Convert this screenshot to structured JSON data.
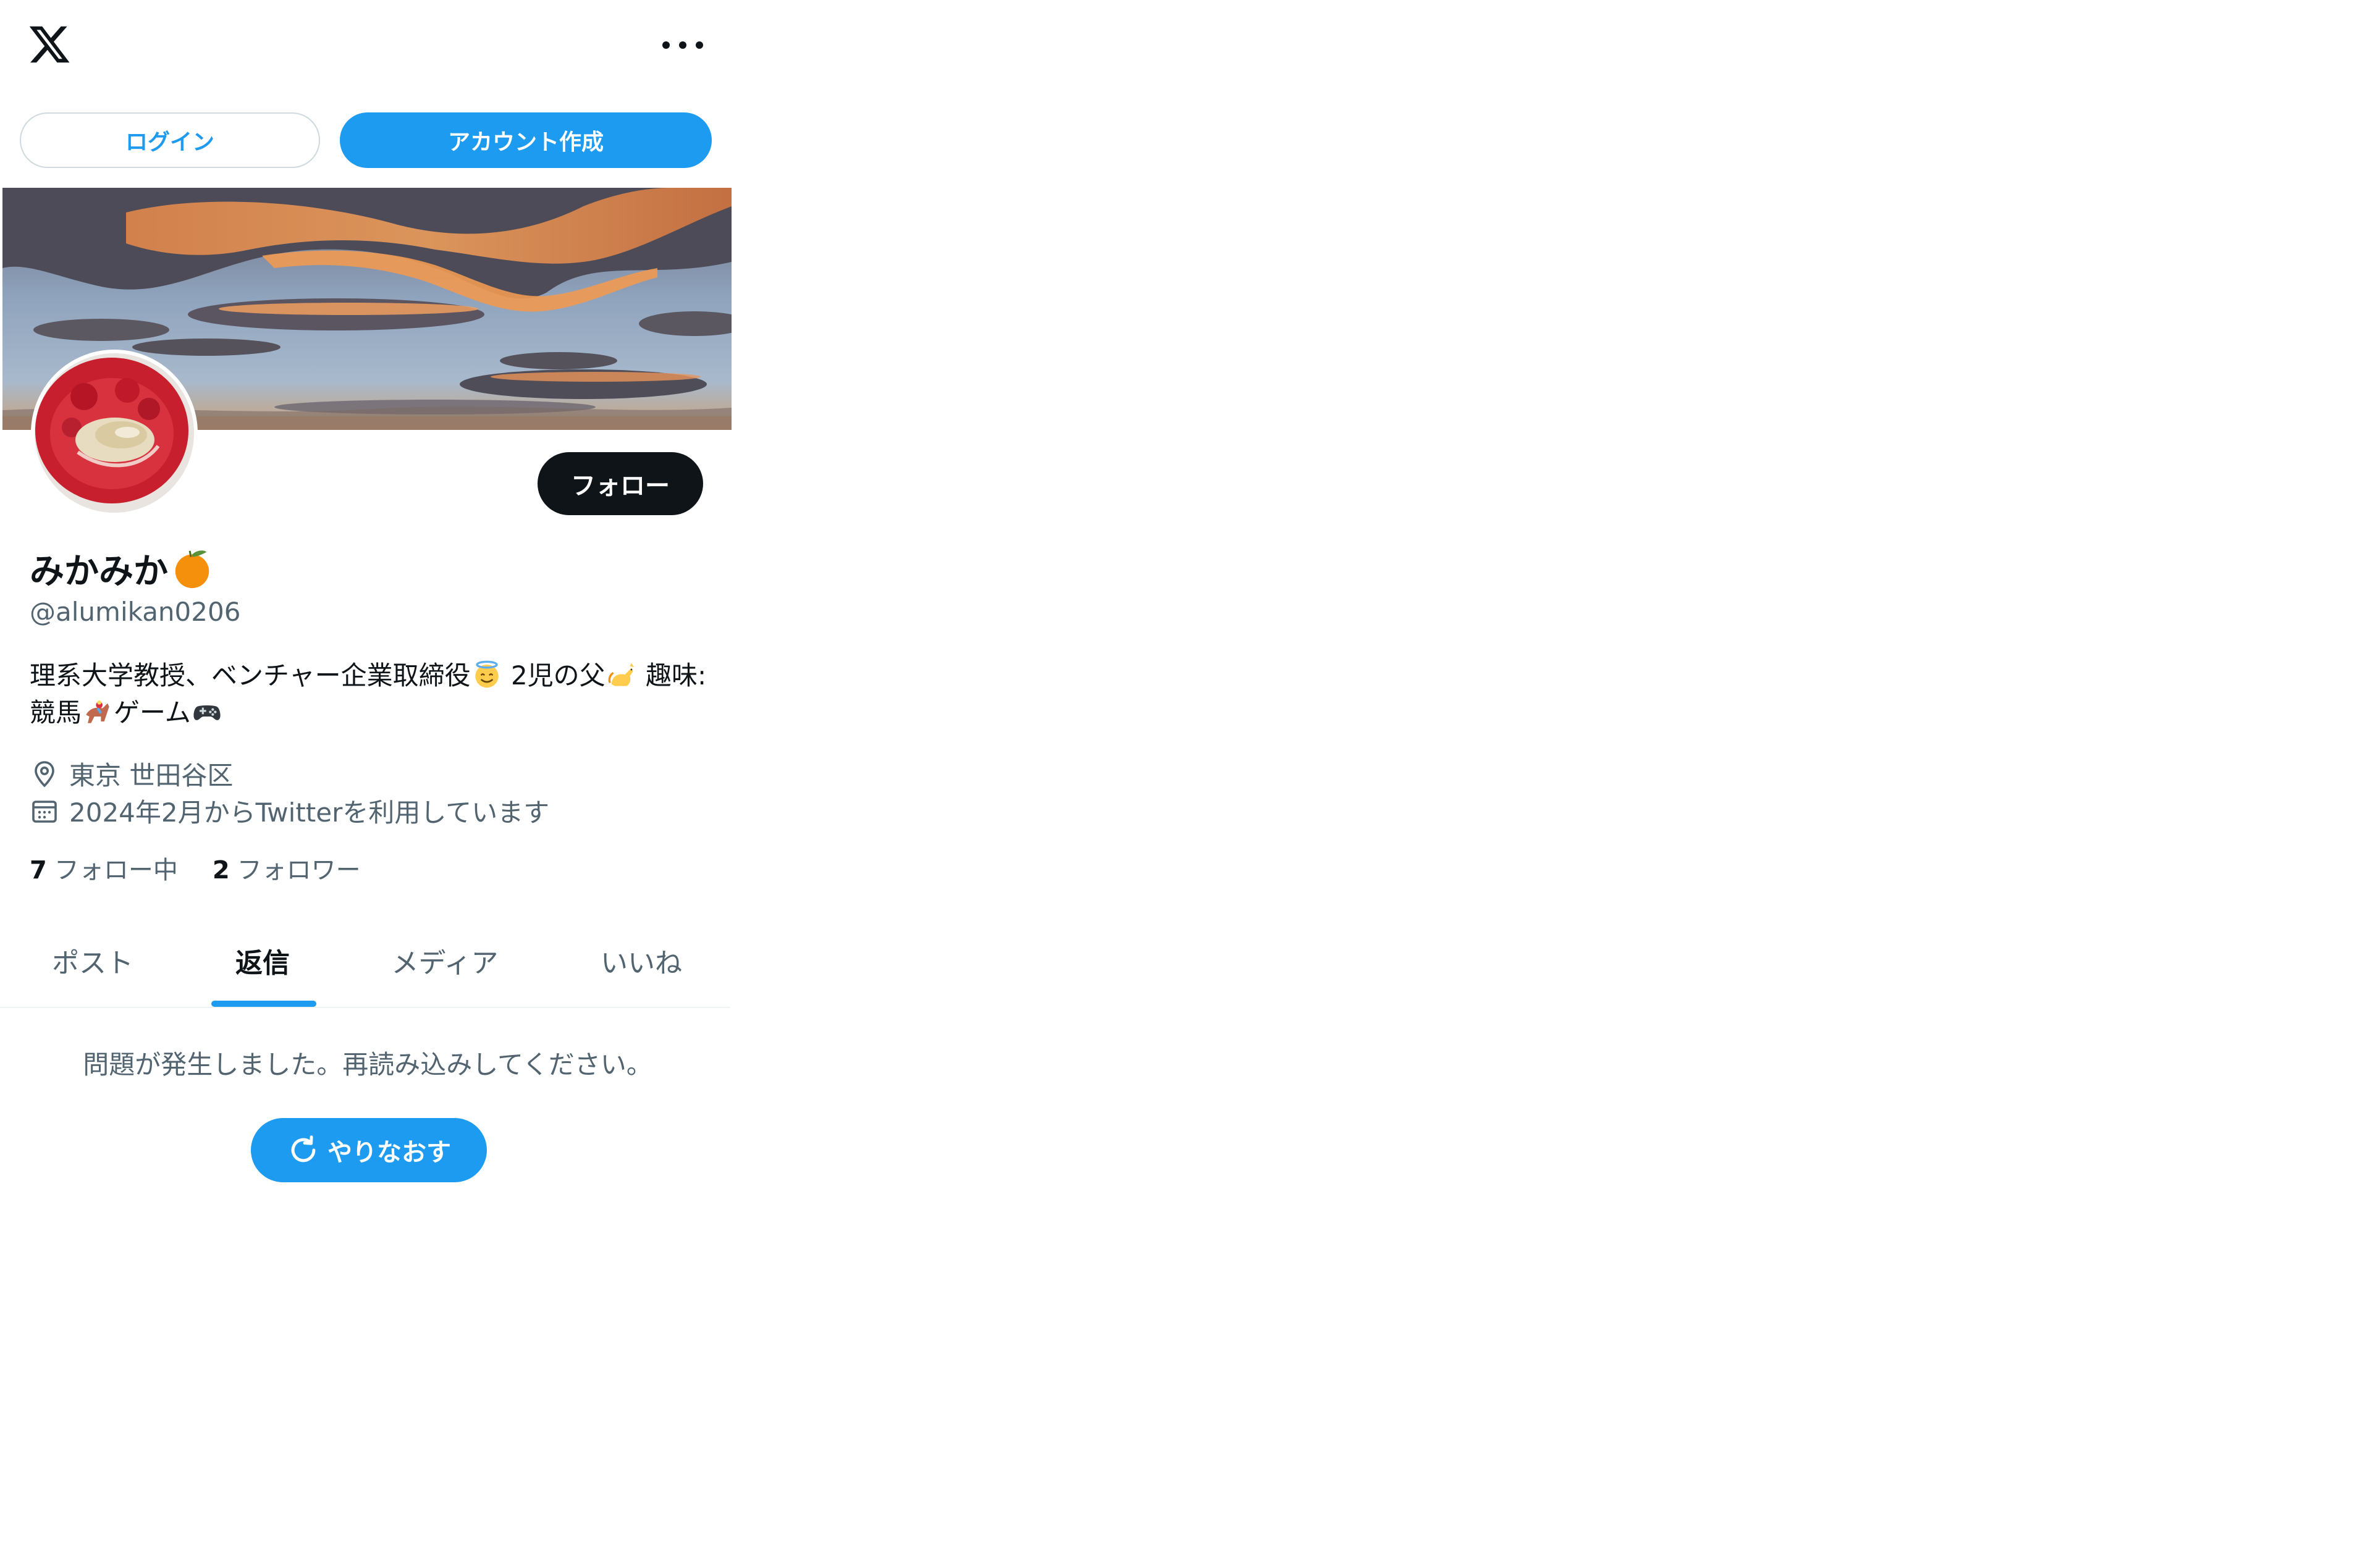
{
  "header": {
    "logo_icon": "x-logo-icon",
    "more_icon": "more-horizontal-icon"
  },
  "auth": {
    "login_label": "ログイン",
    "signup_label": "アカウント作成"
  },
  "profile": {
    "display_name": "みかみか",
    "name_emoji": "orange-icon",
    "handle": "@alumikan0206",
    "follow_label": "フォロー",
    "bio": {
      "seg1": "理系大学教授、ベンチャー企業取締役",
      "emoji1": "smiling-halo-face-icon",
      "seg2": " 2児の父",
      "emoji2": "cat-icon",
      "seg3": " 趣味:競馬",
      "emoji3": "horse-racing-icon",
      "seg4": "ゲーム",
      "emoji4": "game-controller-icon"
    },
    "location": "東京 世田谷区",
    "joined": "2024年2月からTwitterを利用しています",
    "following_count": "7",
    "following_label": "フォロー中",
    "followers_count": "2",
    "followers_label": "フォロワー"
  },
  "tabs": [
    {
      "label": "ポスト",
      "active": false
    },
    {
      "label": "返信",
      "active": true
    },
    {
      "label": "メディア",
      "active": false
    },
    {
      "label": "いいね",
      "active": false
    }
  ],
  "error": {
    "message": "問題が発生しました。再読み込みしてください。",
    "retry_label": "やりなおす"
  },
  "colors": {
    "accent": "#1d9bf0",
    "text_primary": "#0f1419",
    "text_secondary": "#536471",
    "border": "#cfd9de"
  }
}
